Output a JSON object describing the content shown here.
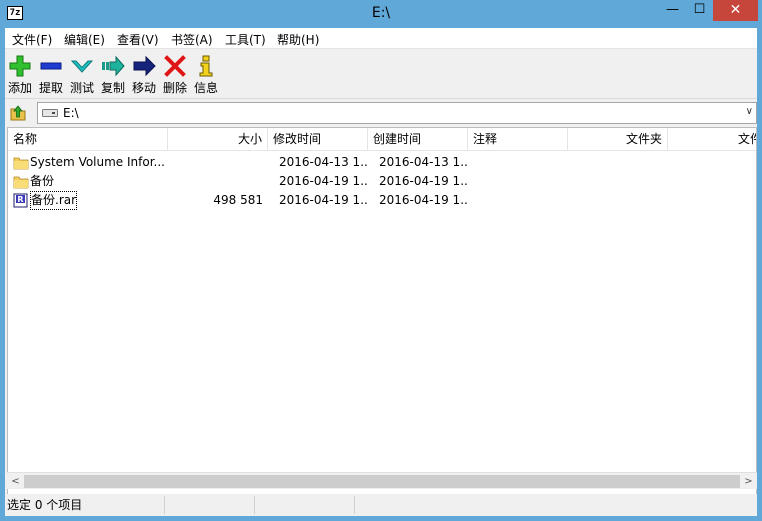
{
  "window": {
    "title": "E:\\",
    "app_icon_text": "7z"
  },
  "controls": {
    "minimize": "—",
    "maximize": "☐",
    "close": "✕"
  },
  "menu": [
    "文件(F)",
    "编辑(E)",
    "查看(V)",
    "书签(A)",
    "工具(T)",
    "帮助(H)"
  ],
  "toolbar": [
    {
      "label": "添加",
      "icon": "add-icon"
    },
    {
      "label": "提取",
      "icon": "extract-icon"
    },
    {
      "label": "测试",
      "icon": "test-icon"
    },
    {
      "label": "复制",
      "icon": "copy-icon"
    },
    {
      "label": "移动",
      "icon": "move-icon"
    },
    {
      "label": "删除",
      "icon": "delete-icon"
    },
    {
      "label": "信息",
      "icon": "info-icon"
    }
  ],
  "address": {
    "path": "E:\\",
    "dropdown": "∨"
  },
  "columns": [
    "名称",
    "大小",
    "修改时间",
    "创建时间",
    "注释",
    "文件夹",
    "文件"
  ],
  "files": [
    {
      "name": "System Volume Infor...",
      "size": "",
      "modified": "2016-04-13 1...",
      "created": "2016-04-13 1...",
      "type": "folder"
    },
    {
      "name": "备份",
      "size": "",
      "modified": "2016-04-19 1...",
      "created": "2016-04-19 1...",
      "type": "folder"
    },
    {
      "name": "备份.rar",
      "size": "498 581",
      "modified": "2016-04-19 1...",
      "created": "2016-04-19 1...",
      "type": "rar"
    }
  ],
  "status": {
    "selection": "选定 0 个项目"
  },
  "colors": {
    "title_bar": "#5fa8d8",
    "close_button": "#c7463b"
  }
}
